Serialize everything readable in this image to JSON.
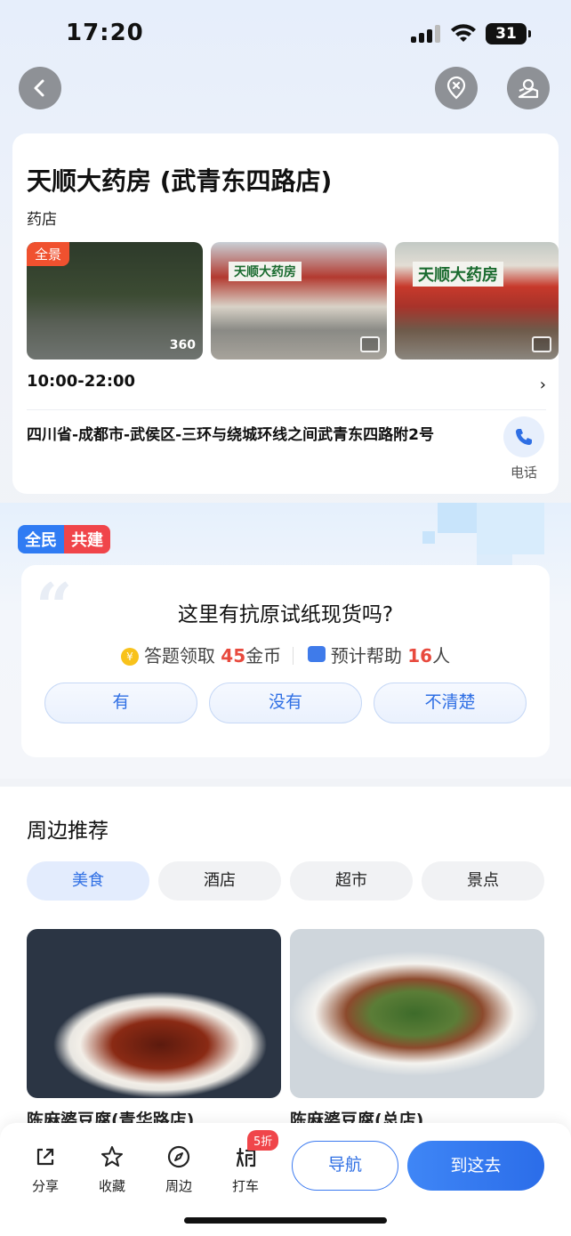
{
  "status_bar": {
    "time": "17:20",
    "battery": "31"
  },
  "place": {
    "name": "天顺大药房 (武青东四路店)",
    "category": "药店",
    "panorama_badge": "全景",
    "panorama_360": "360",
    "hours": "10:00-22:00",
    "address": "四川省-成都市-武侯区-三环与绕城环线之间武青东四路附2号",
    "phone_label": "电话"
  },
  "question": {
    "badge_left": "全民",
    "badge_right": "共建",
    "text": "这里有抗原试纸现货吗?",
    "reward_prefix": "答题领取",
    "reward_amount": "45",
    "reward_suffix": "金币",
    "help_prefix": "预计帮助",
    "help_count": "16",
    "help_suffix": "人",
    "answers": [
      "有",
      "没有",
      "不清楚"
    ]
  },
  "nearby": {
    "title": "周边推荐",
    "tabs": [
      "美食",
      "酒店",
      "超市",
      "景点"
    ],
    "active_tab": 0,
    "items": [
      {
        "name": "陈麻婆豆腐(青华路店)"
      },
      {
        "name": "陈麻婆豆腐(总店)"
      }
    ]
  },
  "bottom_bar": {
    "share": "分享",
    "favorite": "收藏",
    "nearby": "周边",
    "taxi": "打车",
    "taxi_discount": "5折",
    "navigate": "导航",
    "go_here": "到这去"
  },
  "colors": {
    "accent": "#2f6fe4",
    "red": "#e84a3e",
    "discount": "#f0454a"
  }
}
